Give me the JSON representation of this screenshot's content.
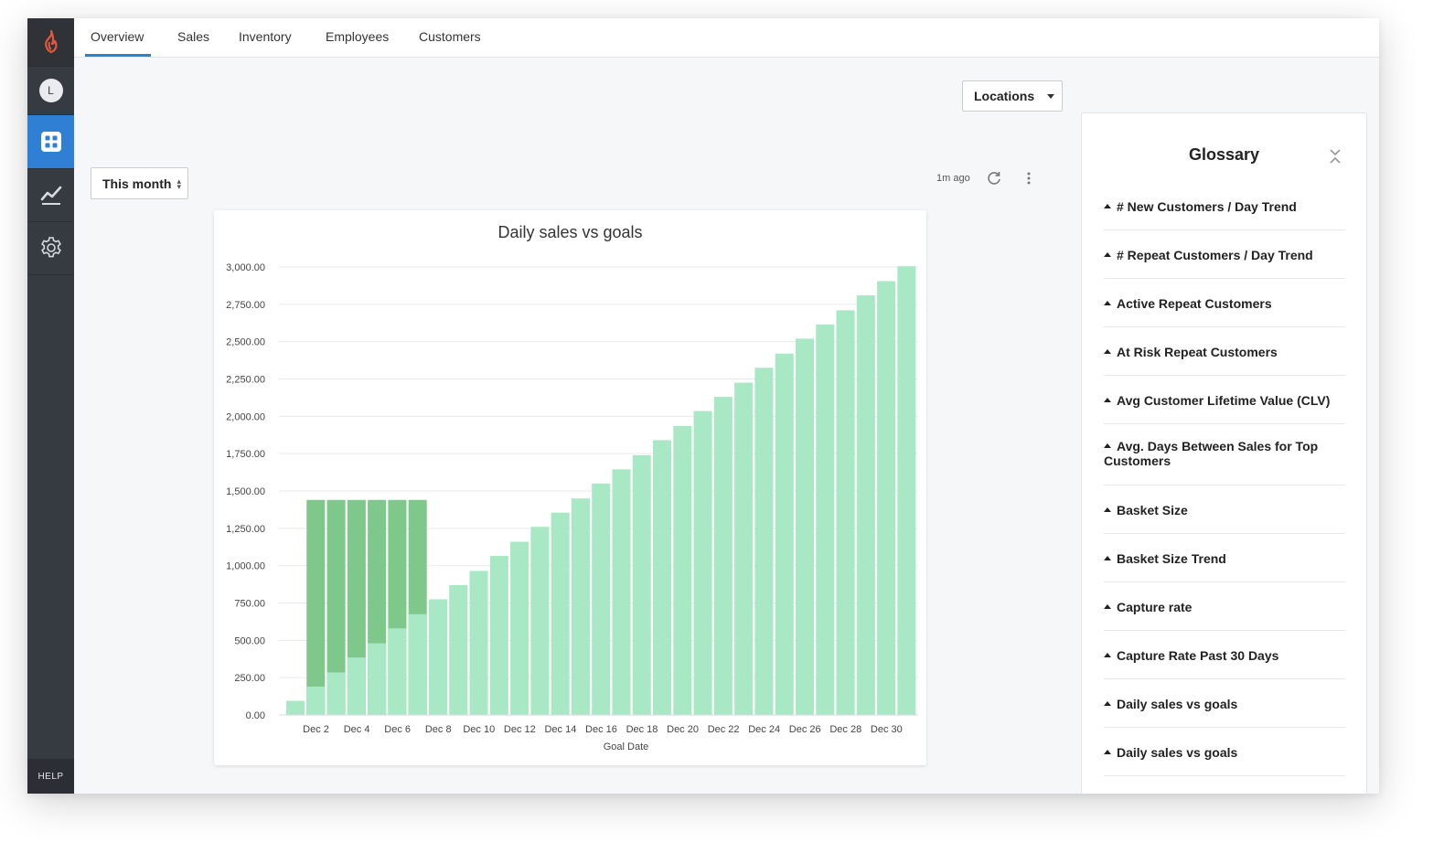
{
  "sidebar": {
    "logo_icon": "flame-logo-icon",
    "avatar_initial": "L",
    "items": [
      {
        "icon": "dashboard-icon",
        "active": true
      },
      {
        "icon": "chart-line-icon",
        "active": false
      },
      {
        "icon": "gear-icon",
        "active": false
      }
    ],
    "help_label": "HELP"
  },
  "tabs": [
    {
      "label": "Overview",
      "active": true
    },
    {
      "label": "Sales",
      "active": false
    },
    {
      "label": "Inventory",
      "active": false
    },
    {
      "label": "Employees",
      "active": false
    },
    {
      "label": "Customers",
      "active": false
    }
  ],
  "filters": {
    "locations_label": "Locations",
    "period_label": "This month"
  },
  "updated_text": "1m ago",
  "chart_data": {
    "type": "bar",
    "title": "Daily sales vs goals",
    "xlabel": "Goal Date",
    "ylabel": "",
    "ylim": [
      0,
      3000
    ],
    "yticks": [
      "0.00",
      "250.00",
      "500.00",
      "750.00",
      "1,000.00",
      "1,250.00",
      "1,500.00",
      "1,750.00",
      "2,000.00",
      "2,250.00",
      "2,500.00",
      "2,750.00",
      "3,000.00"
    ],
    "x_tick_labels": [
      "Dec 2",
      "Dec 4",
      "Dec 6",
      "Dec 8",
      "Dec 10",
      "Dec 12",
      "Dec 14",
      "Dec 16",
      "Dec 18",
      "Dec 20",
      "Dec 22",
      "Dec 24",
      "Dec 26",
      "Dec 28",
      "Dec 30"
    ],
    "categories": [
      "Dec 1",
      "Dec 2",
      "Dec 3",
      "Dec 4",
      "Dec 5",
      "Dec 6",
      "Dec 7",
      "Dec 8",
      "Dec 9",
      "Dec 10",
      "Dec 11",
      "Dec 12",
      "Dec 13",
      "Dec 14",
      "Dec 15",
      "Dec 16",
      "Dec 17",
      "Dec 18",
      "Dec 19",
      "Dec 20",
      "Dec 21",
      "Dec 22",
      "Dec 23",
      "Dec 24",
      "Dec 25",
      "Dec 26",
      "Dec 27",
      "Dec 28",
      "Dec 29",
      "Dec 30",
      "Dec 31"
    ],
    "series": [
      {
        "values": [
          95,
          190,
          285,
          385,
          480,
          580,
          675,
          775,
          870,
          965,
          1065,
          1160,
          1260,
          1355,
          1450,
          1550,
          1645,
          1740,
          1840,
          1935,
          2035,
          2130,
          2225,
          2325,
          2420,
          2520,
          2615,
          2710,
          2810,
          2905,
          3005
        ],
        "color": "#a9e8c5"
      },
      {
        "values": [
          0,
          1440,
          1440,
          1440,
          1440,
          1440,
          1440,
          0,
          0,
          0,
          0,
          0,
          0,
          0,
          0,
          0,
          0,
          0,
          0,
          0,
          0,
          0,
          0,
          0,
          0,
          0,
          0,
          0,
          0,
          0,
          0
        ],
        "color": "#7dc88a"
      }
    ],
    "grid": true,
    "legend": "none"
  },
  "glossary": {
    "title": "Glossary",
    "items": [
      "# New Customers / Day Trend",
      "# Repeat Customers / Day Trend",
      "Active Repeat Customers",
      "At Risk Repeat Customers",
      "Avg Customer Lifetime Value (CLV)",
      "Avg. Days Between Sales for Top Customers",
      "Basket Size",
      "Basket Size Trend",
      "Capture rate",
      "Capture Rate Past 30 Days",
      "Daily sales vs goals",
      "Daily sales vs goals"
    ]
  }
}
